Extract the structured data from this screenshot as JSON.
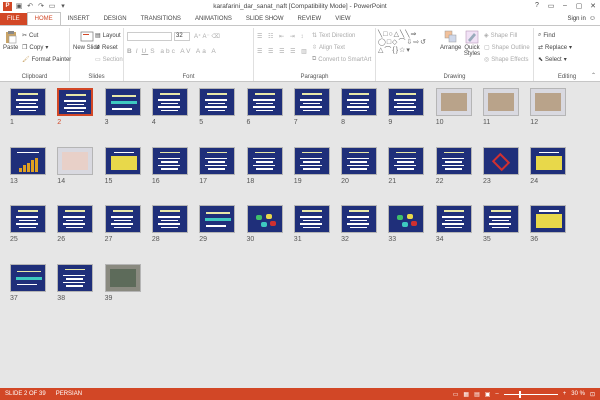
{
  "window": {
    "title": "karafarini_dar_sanat_naft [Compatibility Mode] - PowerPoint",
    "app_badge": "P",
    "controls": [
      "?",
      "▭",
      "–",
      "▢",
      "✕"
    ]
  },
  "tabs": [
    {
      "label": "FILE",
      "kind": "file"
    },
    {
      "label": "HOME",
      "kind": "active"
    },
    {
      "label": "INSERT",
      "kind": ""
    },
    {
      "label": "DESIGN",
      "kind": ""
    },
    {
      "label": "TRANSITIONS",
      "kind": ""
    },
    {
      "label": "ANIMATIONS",
      "kind": ""
    },
    {
      "label": "SLIDE SHOW",
      "kind": ""
    },
    {
      "label": "REVIEW",
      "kind": ""
    },
    {
      "label": "VIEW",
      "kind": ""
    }
  ],
  "signin": {
    "label": "Sign in"
  },
  "ribbon": {
    "clipboard": {
      "label": "Clipboard",
      "paste": "Paste",
      "cut": "Cut",
      "copy": "Copy",
      "format_painter": "Format Painter"
    },
    "slides": {
      "label": "Slides",
      "new_slide": "New Slide",
      "layout": "Layout",
      "reset": "Reset",
      "section": "Section"
    },
    "font": {
      "label": "Font",
      "size": "32"
    },
    "paragraph": {
      "label": "Paragraph",
      "text_direction": "Text Direction",
      "align_text": "Align Text",
      "convert": "Convert to SmartArt"
    },
    "drawing": {
      "label": "Drawing",
      "arrange": "Arrange",
      "quick_styles": "Quick Styles",
      "shape_fill": "Shape Fill",
      "shape_outline": "Shape Outline",
      "shape_effects": "Shape Effects"
    },
    "editing": {
      "label": "Editing",
      "find": "Find",
      "replace": "Replace",
      "select": "Select"
    }
  },
  "slides": [
    {
      "n": "1",
      "kind": "text"
    },
    {
      "n": "2",
      "kind": "text",
      "selected": true
    },
    {
      "n": "3",
      "kind": "cyan"
    },
    {
      "n": "4",
      "kind": "text"
    },
    {
      "n": "5",
      "kind": "text"
    },
    {
      "n": "6",
      "kind": "text"
    },
    {
      "n": "7",
      "kind": "text"
    },
    {
      "n": "8",
      "kind": "text"
    },
    {
      "n": "9",
      "kind": "text"
    },
    {
      "n": "10",
      "kind": "image"
    },
    {
      "n": "11",
      "kind": "image"
    },
    {
      "n": "12",
      "kind": "image"
    },
    {
      "n": "13",
      "kind": "chart"
    },
    {
      "n": "14",
      "kind": "map"
    },
    {
      "n": "15",
      "kind": "yellow"
    },
    {
      "n": "16",
      "kind": "text"
    },
    {
      "n": "17",
      "kind": "text"
    },
    {
      "n": "18",
      "kind": "text"
    },
    {
      "n": "19",
      "kind": "text"
    },
    {
      "n": "20",
      "kind": "text"
    },
    {
      "n": "21",
      "kind": "text"
    },
    {
      "n": "22",
      "kind": "text"
    },
    {
      "n": "23",
      "kind": "red"
    },
    {
      "n": "24",
      "kind": "yellow"
    },
    {
      "n": "25",
      "kind": "text"
    },
    {
      "n": "26",
      "kind": "text"
    },
    {
      "n": "27",
      "kind": "text"
    },
    {
      "n": "28",
      "kind": "text"
    },
    {
      "n": "29",
      "kind": "cyan"
    },
    {
      "n": "30",
      "kind": "shapes"
    },
    {
      "n": "31",
      "kind": "text"
    },
    {
      "n": "32",
      "kind": "text"
    },
    {
      "n": "33",
      "kind": "shapes"
    },
    {
      "n": "34",
      "kind": "text"
    },
    {
      "n": "35",
      "kind": "text"
    },
    {
      "n": "36",
      "kind": "yellow"
    },
    {
      "n": "37",
      "kind": "cyan"
    },
    {
      "n": "38",
      "kind": "text"
    },
    {
      "n": "39",
      "kind": "photo"
    }
  ],
  "status": {
    "slide": "SLIDE 2 OF 39",
    "language": "PERSIAN",
    "zoom": "30 %",
    "zoom_fraction": 0.3
  },
  "colors": {
    "accent": "#d24726",
    "slide_bg": "#1f2f7a"
  }
}
